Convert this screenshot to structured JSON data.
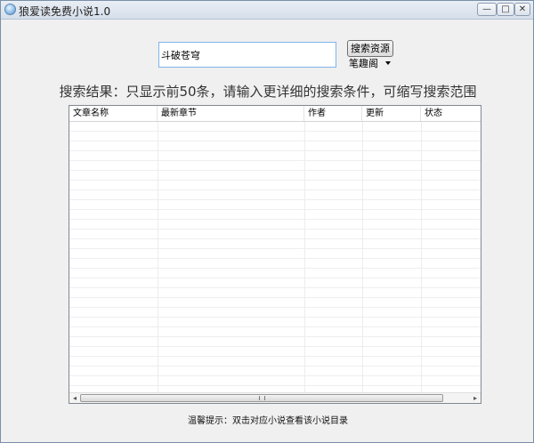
{
  "window": {
    "title": "狼爱读免费小说1.0",
    "controls": {
      "minimize": "—",
      "maximize": "□",
      "close": "✕"
    }
  },
  "search": {
    "query": "斗破苍穹",
    "button_label": "搜索资源",
    "source_selected": "笔趣阁"
  },
  "result_message": "搜索结果：只显示前50条，请输入更详细的搜索条件，可缩写搜索范围",
  "table": {
    "columns": [
      "文章名称",
      "最新章节",
      "作者",
      "更新",
      "状态"
    ],
    "rows": []
  },
  "scrollbar": {
    "left_arrow": "◂",
    "right_arrow": "▸"
  },
  "hint": "温馨提示：双击对应小说查看该小说目录",
  "colors": {
    "input_border": "#7eb4ea",
    "window_bg": "#f0f0f0",
    "grid_line": "#eeeeee"
  },
  "icons": {
    "app": "app-icon",
    "dropdown": "chevron-down-icon"
  }
}
